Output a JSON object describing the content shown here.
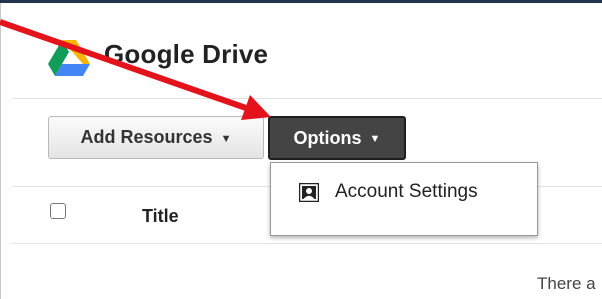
{
  "header": {
    "title": "Google Drive",
    "logo_icon": "google-drive-logo"
  },
  "toolbar": {
    "add_resources_label": "Add Resources",
    "options_label": "Options",
    "caret_icon": "caret-down-icon"
  },
  "options_menu": {
    "items": [
      {
        "label": "Account Settings",
        "icon": "account-card-icon"
      }
    ]
  },
  "table": {
    "columns": [
      "Title"
    ]
  },
  "empty_state": {
    "message": "There a"
  },
  "annotation": {
    "arrow_color": "#e3121b"
  },
  "colors": {
    "options_button_bg": "#444444",
    "top_bar": "#22334d"
  }
}
